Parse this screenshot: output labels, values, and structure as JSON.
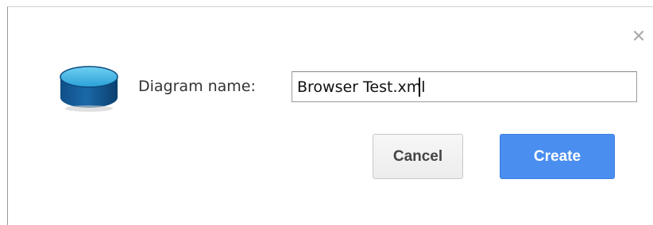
{
  "dialog": {
    "close_glyph": "✕",
    "icon": "database-icon",
    "name_label": "Diagram name:",
    "name_value": "Browser Test.xml",
    "cancel_label": "Cancel",
    "create_label": "Create",
    "colors": {
      "primary_button": "#4a8ef0",
      "icon_blue": "#1f6ea8"
    }
  }
}
